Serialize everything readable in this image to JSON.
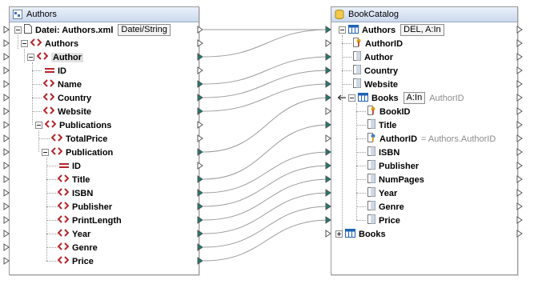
{
  "source": {
    "title": "Authors",
    "file_label": "Datei: Authors.xml",
    "file_button": "Datei/String",
    "rows": [
      {
        "label": "Authors"
      },
      {
        "label": "Author"
      },
      {
        "label": "ID"
      },
      {
        "label": "Name"
      },
      {
        "label": "Country"
      },
      {
        "label": "Website"
      },
      {
        "label": "Publications"
      },
      {
        "label": "TotalPrice"
      },
      {
        "label": "Publication"
      },
      {
        "label": "ID"
      },
      {
        "label": "Title"
      },
      {
        "label": "ISBN"
      },
      {
        "label": "Publisher"
      },
      {
        "label": "PrintLength"
      },
      {
        "label": "Year"
      },
      {
        "label": "Genre"
      },
      {
        "label": "Price"
      }
    ]
  },
  "target": {
    "title": "BookCatalog",
    "authors_table": "Authors",
    "authors_tag": "DEL, A:In",
    "rows": [
      {
        "label": "AuthorID"
      },
      {
        "label": "Author"
      },
      {
        "label": "Country"
      },
      {
        "label": "Website"
      },
      {
        "label": "Books"
      },
      {
        "label": "BookID"
      },
      {
        "label": "Title"
      },
      {
        "label": "AuthorID"
      },
      {
        "label": "ISBN"
      },
      {
        "label": "Publisher"
      },
      {
        "label": "NumPages"
      },
      {
        "label": "Year"
      },
      {
        "label": "Genre"
      },
      {
        "label": "Price"
      },
      {
        "label": "Books"
      }
    ],
    "books_tag": "A:In",
    "books_note": "AuthorID",
    "authorid_note": "= Authors.AuthorID"
  },
  "colors": {
    "title_bar": "#cbd9ee",
    "element_icon": "#b3262a",
    "table_icon": "#1f63b4",
    "key_icon": "#e0a010",
    "connector": "#1b7a74",
    "wire": "#9a9a9a"
  }
}
